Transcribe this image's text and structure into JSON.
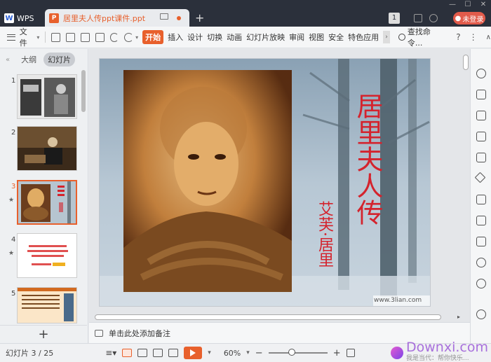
{
  "app": {
    "name": "WPS",
    "doc_tab_title": "居里夫人传ppt课件.ppt",
    "page_badge": "1",
    "login_label": "未登录"
  },
  "menu": {
    "file_label": "文件",
    "tabs": [
      "开始",
      "插入",
      "设计",
      "切换",
      "动画",
      "幻灯片放映",
      "审阅",
      "视图",
      "安全",
      "特色应用"
    ],
    "active_tab": "开始",
    "search_label": "查找命令...",
    "help_label": "?"
  },
  "left_panel": {
    "outline_label": "大纲",
    "slides_label": "幻灯片",
    "thumbnails": [
      {
        "num": "1",
        "starred": false,
        "active": false
      },
      {
        "num": "2",
        "starred": false,
        "active": false
      },
      {
        "num": "3",
        "starred": true,
        "active": true
      },
      {
        "num": "4",
        "starred": true,
        "active": false
      },
      {
        "num": "5",
        "starred": false,
        "active": false
      }
    ],
    "add_label": "+"
  },
  "slide": {
    "title": "居里夫人传",
    "author": "艾芙·居里",
    "watermark": "www.3lian.com"
  },
  "notes": {
    "placeholder": "单击此处添加备注"
  },
  "status": {
    "pages": "幻灯片 3 / 25",
    "zoom": "60%",
    "zoom_level_percent": 60
  },
  "watermark": {
    "brand": "Downxi.com",
    "sub": "我是当代：帮你快乐..."
  },
  "colors": {
    "accent": "#e8602c",
    "titlebar": "#2b303b",
    "login": "#e25b4b",
    "slide_title": "#d4232d"
  }
}
